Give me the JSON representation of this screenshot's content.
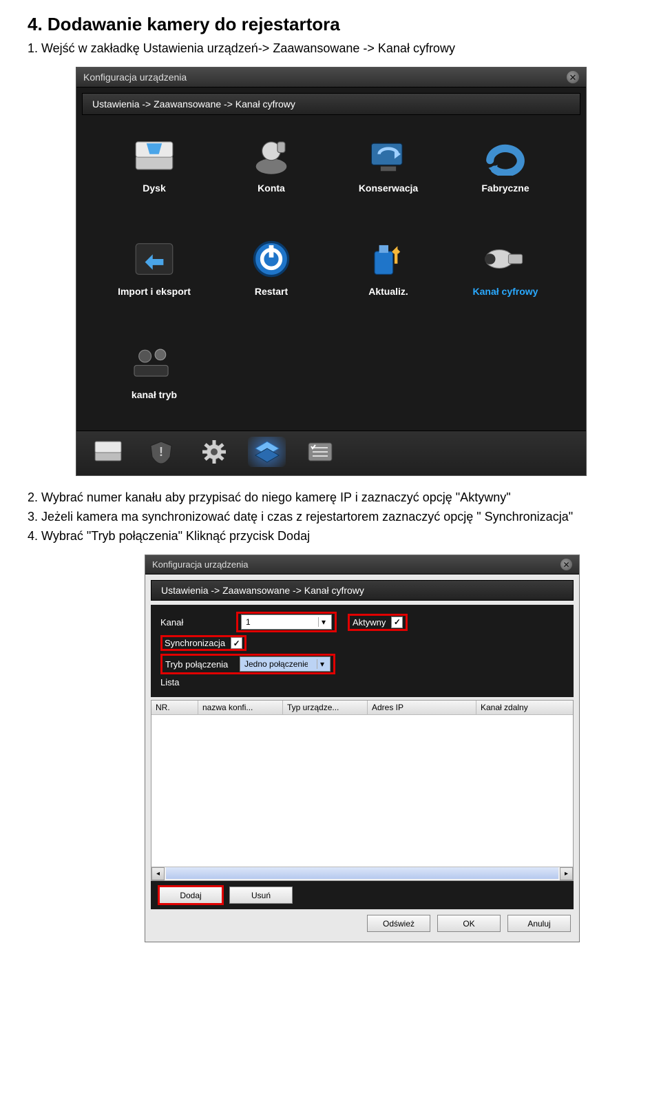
{
  "section": {
    "heading": "4. Dodawanie kamery do rejestartora"
  },
  "instructions": [
    "Wejść w zakładkę Ustawienia urządzeń-> Zaawansowane -> Kanał cyfrowy",
    "Wybrać numer kanału aby przypisać do niego kamerę IP i zaznaczyć opcję \"Aktywny\"",
    "Jeżeli kamera ma synchronizować datę i czas z rejestartorem zaznaczyć opcję \" Synchronizacja\"",
    "Wybrać \"Tryb połączenia\" Kliknąć przycisk Dodaj"
  ],
  "win1": {
    "title": "Konfiguracja urządzenia",
    "breadcrumb": "Ustawienia -> Zaawansowane -> Kanał cyfrowy",
    "items": [
      {
        "label": "Dysk"
      },
      {
        "label": "Konta"
      },
      {
        "label": "Konserwacja"
      },
      {
        "label": "Fabryczne"
      },
      {
        "label": "Import i eksport"
      },
      {
        "label": "Restart"
      },
      {
        "label": "Aktualiz."
      },
      {
        "label": "Kanał cyfrowy"
      },
      {
        "label": "kanał tryb"
      }
    ]
  },
  "win2": {
    "title": "Konfiguracja urządzenia",
    "breadcrumb": "Ustawienia -> Zaawansowane -> Kanał cyfrowy",
    "labels": {
      "kanal": "Kanał",
      "aktywny": "Aktywny",
      "synchronizacja": "Synchronizacja",
      "tryb": "Tryb połączenia",
      "lista": "Lista"
    },
    "values": {
      "kanal": "1",
      "tryb": "Jedno połączenie",
      "chk_aktywny": "✓",
      "chk_sync": "✓"
    },
    "columns": [
      "NR.",
      "nazwa konfi...",
      "Typ urządze...",
      "Adres IP",
      "Kanał zdalny"
    ],
    "buttons": {
      "dodaj": "Dodaj",
      "usun": "Usuń",
      "odswiez": "Odśwież",
      "ok": "OK",
      "anuluj": "Anuluj"
    }
  }
}
